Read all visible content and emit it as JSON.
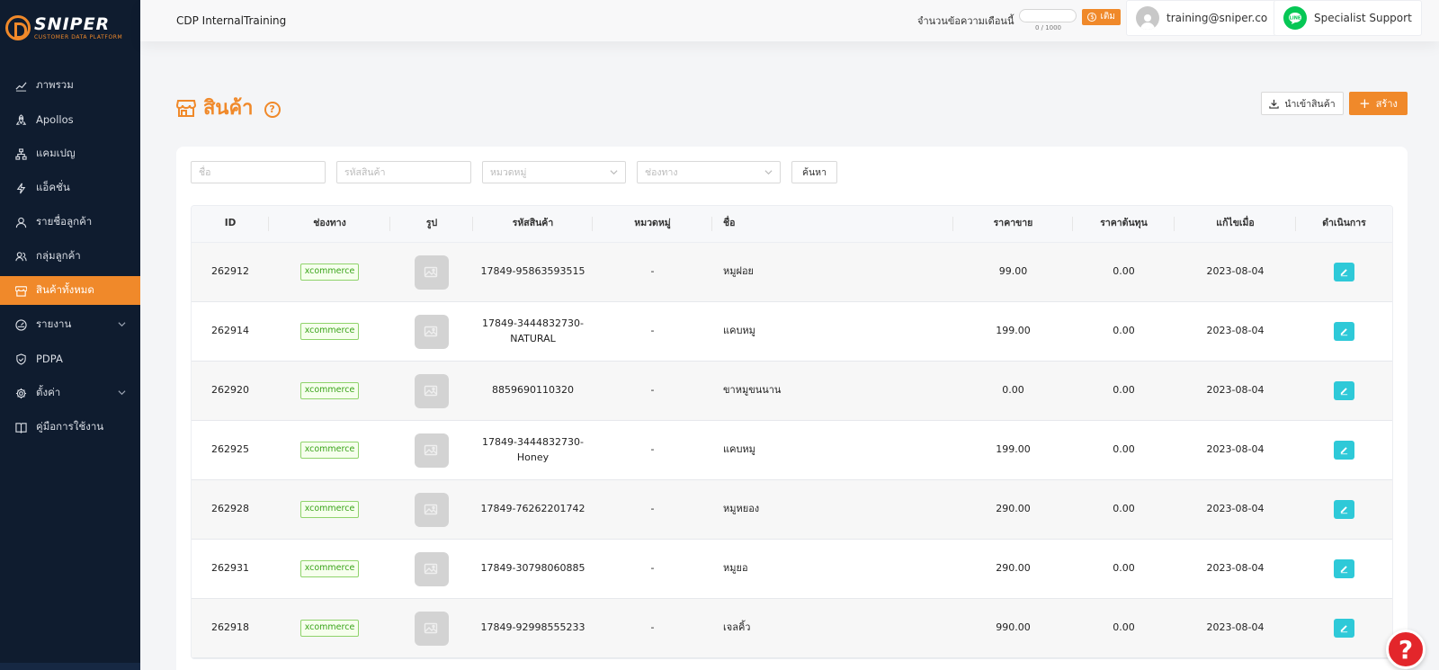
{
  "brand": {
    "name": "SNIPER",
    "subtitle": "CUSTOMER DATA PLATFORM",
    "accent": "#f0892a",
    "sidebar_bg": "#0f1c2f"
  },
  "sidebar": {
    "items": [
      {
        "label": "ภาพรวม",
        "icon": "chart-line-icon"
      },
      {
        "label": "Apollos",
        "icon": "rocket-icon"
      },
      {
        "label": "แคมเปญ",
        "icon": "sitemap-icon"
      },
      {
        "label": "แอ็คชั่น",
        "icon": "lightning-icon"
      },
      {
        "label": "รายชื่อลูกค้า",
        "icon": "user-icon"
      },
      {
        "label": "กลุ่มลูกค้า",
        "icon": "users-icon"
      },
      {
        "label": "สินค้าทั้งหมด",
        "icon": "shop-icon",
        "active": true
      },
      {
        "label": "รายงาน",
        "icon": "dashboard-icon",
        "expandable": true
      },
      {
        "label": "PDPA",
        "icon": "shield-icon"
      },
      {
        "label": "ตั้งค่า",
        "icon": "gear-icon",
        "expandable": true
      },
      {
        "label": "คู่มือการใช้งาน",
        "icon": "book-icon"
      }
    ]
  },
  "header": {
    "app_title": "CDP InternalTraining",
    "quota_label": "จำนวนข้อความเดือนนี้",
    "quota_count": "0 / 1000",
    "quota_fraction": 0,
    "topup_label": "เติม",
    "user_email": "training@sniper.co",
    "support_label": "Specialist Support"
  },
  "page": {
    "title": "สินค้า",
    "import_label": "นำเข้าสินค้า",
    "create_label": "สร้าง"
  },
  "filters": {
    "name_placeholder": "ชื่อ",
    "code_placeholder": "รหัสสินค้า",
    "category_placeholder": "หมวดหมู่",
    "channel_placeholder": "ช่องทาง",
    "search_label": "ค้นหา"
  },
  "table": {
    "headers": {
      "id": "ID",
      "channel": "ช่องทาง",
      "image": "รูป",
      "code": "รหัสสินค้า",
      "category": "หมวดหมู่",
      "name": "ชื่อ",
      "price": "ราคาขาย",
      "cost": "ราคาต้นทุน",
      "updated": "แก้ไขเมื่อ",
      "actions": "ดำเนินการ"
    },
    "rows": [
      {
        "id": "262912",
        "channel": "xcommerce",
        "code": "17849-95863593515",
        "category": "-",
        "name": "หมูฝอย",
        "price": "99.00",
        "cost": "0.00",
        "updated": "2023-08-04"
      },
      {
        "id": "262914",
        "channel": "xcommerce",
        "code": "17849-3444832730-NATURAL",
        "category": "-",
        "name": "แคบหมู",
        "price": "199.00",
        "cost": "0.00",
        "updated": "2023-08-04"
      },
      {
        "id": "262920",
        "channel": "xcommerce",
        "code": "8859690110320",
        "category": "-",
        "name": "ขาหมูขนนาน",
        "price": "0.00",
        "cost": "0.00",
        "updated": "2023-08-04"
      },
      {
        "id": "262925",
        "channel": "xcommerce",
        "code": "17849-3444832730-Honey",
        "category": "-",
        "name": "แคบหมู",
        "price": "199.00",
        "cost": "0.00",
        "updated": "2023-08-04"
      },
      {
        "id": "262928",
        "channel": "xcommerce",
        "code": "17849-76262201742",
        "category": "-",
        "name": "หมูหยอง",
        "price": "290.00",
        "cost": "0.00",
        "updated": "2023-08-04"
      },
      {
        "id": "262931",
        "channel": "xcommerce",
        "code": "17849-30798060885",
        "category": "-",
        "name": "หมูยอ",
        "price": "290.00",
        "cost": "0.00",
        "updated": "2023-08-04"
      },
      {
        "id": "262918",
        "channel": "xcommerce",
        "code": "17849-92998555233",
        "category": "-",
        "name": "เจลคิ้ว",
        "price": "990.00",
        "cost": "0.00",
        "updated": "2023-08-04"
      }
    ]
  },
  "help_fab": {
    "label": "?"
  }
}
